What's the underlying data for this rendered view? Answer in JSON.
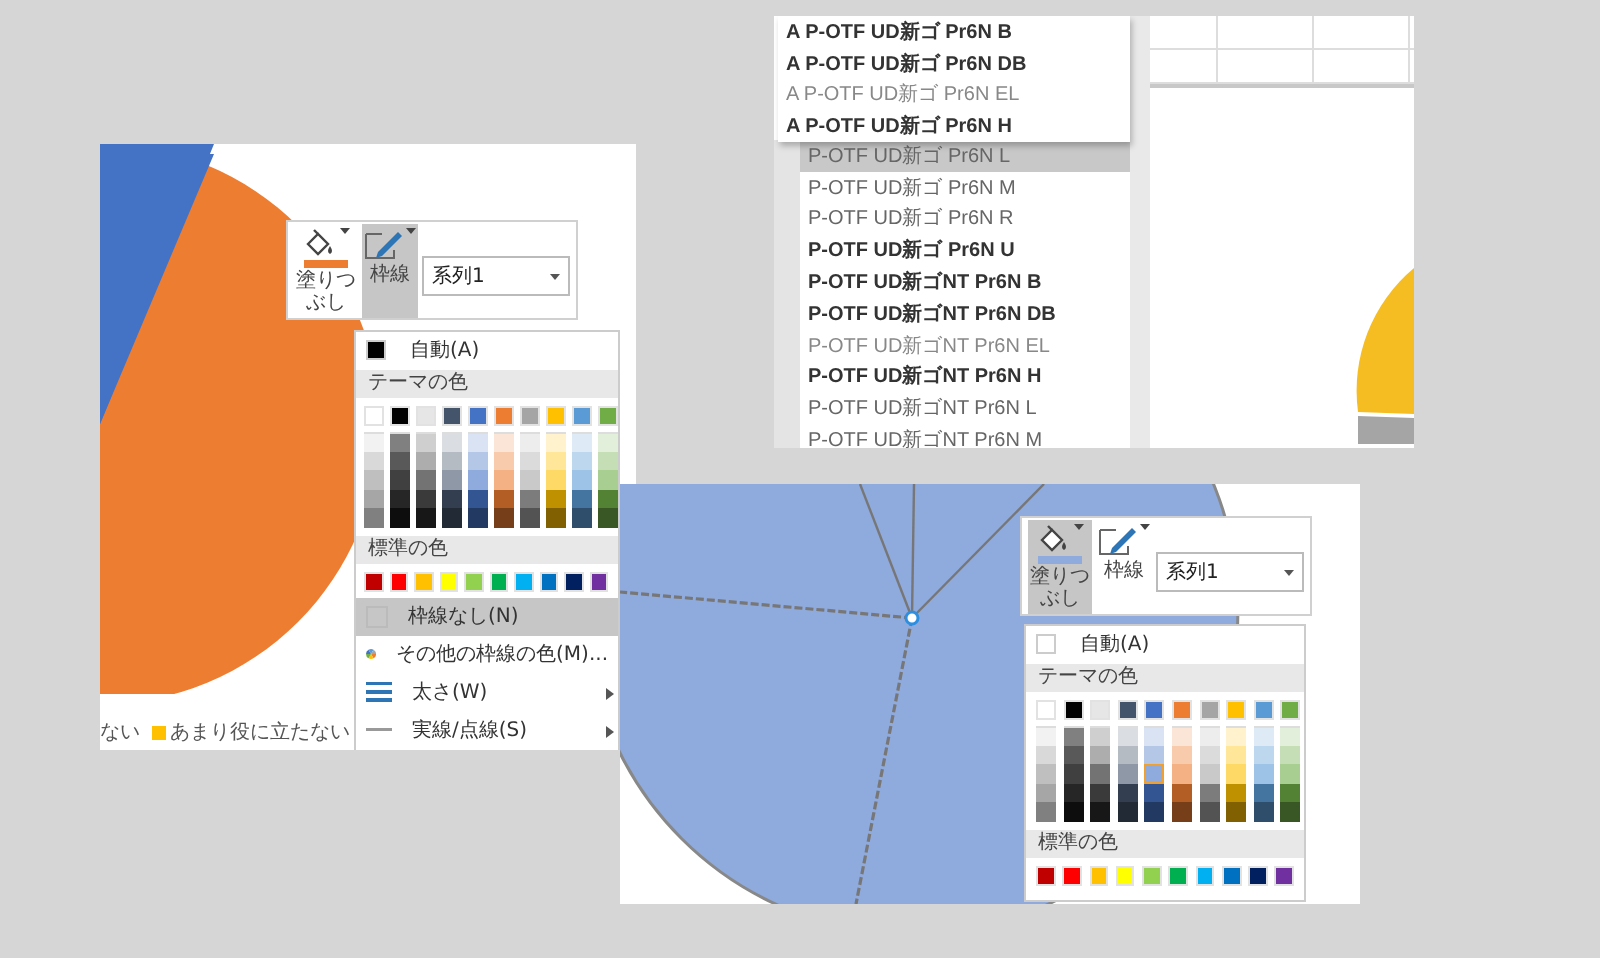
{
  "left_window": {
    "toolbar": {
      "buttons": [
        {
          "kind": "fill",
          "label": "塗りつぶし",
          "selected": false,
          "color": "#ed7d31"
        },
        {
          "kind": "outline",
          "label": "枠線",
          "selected": true
        }
      ],
      "series": "系列1"
    },
    "menu": [
      {
        "kind": "auto",
        "label": "自動(A)",
        "color": "#000000"
      },
      {
        "kind": "header",
        "label": "テーマの色"
      },
      {
        "kind": "theme_palette",
        "columns": [
          {
            "color": "#ffffff",
            "shades": [
              {
                "selected": false
              },
              {
                "selected": false
              },
              {
                "selected": false
              },
              {
                "selected": false
              },
              {
                "selected": false
              }
            ]
          },
          {
            "color": "#000000",
            "shades": [
              {
                "selected": false
              },
              {
                "selected": false
              },
              {
                "selected": false
              },
              {
                "selected": false
              },
              {
                "selected": false
              }
            ]
          },
          {
            "color": "#e7e6e6",
            "shades": [
              {
                "selected": false
              },
              {
                "selected": false
              },
              {
                "selected": false
              },
              {
                "selected": false
              },
              {
                "selected": false
              }
            ]
          },
          {
            "color": "#44546a",
            "shades": [
              {
                "selected": false
              },
              {
                "selected": false
              },
              {
                "selected": false
              },
              {
                "selected": false
              },
              {
                "selected": false
              }
            ]
          },
          {
            "color": "#4472c4",
            "shades": [
              {
                "selected": false
              },
              {
                "selected": false
              },
              {
                "selected": false
              },
              {
                "selected": false
              },
              {
                "selected": false
              }
            ]
          },
          {
            "color": "#ed7d31",
            "shades": [
              {
                "selected": false
              },
              {
                "selected": false
              },
              {
                "selected": false
              },
              {
                "selected": false
              },
              {
                "selected": false
              }
            ]
          },
          {
            "color": "#a5a5a5",
            "shades": [
              {
                "selected": false
              },
              {
                "selected": false
              },
              {
                "selected": false
              },
              {
                "selected": false
              },
              {
                "selected": false
              }
            ]
          },
          {
            "color": "#ffc000",
            "shades": [
              {
                "selected": false
              },
              {
                "selected": false
              },
              {
                "selected": false
              },
              {
                "selected": false
              },
              {
                "selected": false
              }
            ]
          },
          {
            "color": "#5b9bd5",
            "shades": [
              {
                "selected": false
              },
              {
                "selected": false
              },
              {
                "selected": false
              },
              {
                "selected": false
              },
              {
                "selected": false
              }
            ]
          },
          {
            "color": "#70ad47",
            "shades": [
              {
                "selected": false
              },
              {
                "selected": false
              },
              {
                "selected": false
              },
              {
                "selected": false
              },
              {
                "selected": false
              }
            ]
          }
        ]
      },
      {
        "kind": "header",
        "label": "標準の色"
      },
      {
        "kind": "standard_palette",
        "colors": [
          {
            "color": "#c00000"
          },
          {
            "color": "#ff0000"
          },
          {
            "color": "#ffc000"
          },
          {
            "color": "#ffff00"
          },
          {
            "color": "#92d050"
          },
          {
            "color": "#00b050"
          },
          {
            "color": "#00b0f0"
          },
          {
            "color": "#0070c0"
          },
          {
            "color": "#002060"
          },
          {
            "color": "#7030a0"
          }
        ]
      },
      {
        "kind": "nocolor",
        "label": "枠線なし(N)",
        "selected": true,
        "submenu": false
      },
      {
        "kind": "morecolors",
        "label": "その他の枠線の色(M)...",
        "selected": false,
        "submenu": false
      },
      {
        "kind": "weight",
        "label": "太さ(W)",
        "selected": false,
        "submenu": true
      },
      {
        "kind": "linestyle",
        "label": "実線/点線(S)",
        "selected": false,
        "submenu": true
      }
    ],
    "legend": [
      {
        "label": "ない"
      },
      {
        "label": "あまり役に立たない",
        "color": "#ffc000"
      }
    ]
  },
  "font_window": {
    "popup": [
      {
        "label": "A P-OTF UD新ゴ Pr6N B",
        "kind": "bold"
      },
      {
        "label": "A P-OTF UD新ゴ Pr6N DB",
        "kind": "bold"
      },
      {
        "label": "A P-OTF UD新ゴ Pr6N EL",
        "kind": "light"
      },
      {
        "label": "A P-OTF UD新ゴ Pr6N H",
        "kind": "bold"
      }
    ],
    "list": [
      {
        "label": "P-OTF UD新ゴ Pr6N L",
        "kind": "normal",
        "selected": true
      },
      {
        "label": "P-OTF UD新ゴ Pr6N M",
        "kind": "normal",
        "selected": false
      },
      {
        "label": "P-OTF UD新ゴ Pr6N R",
        "kind": "normal",
        "selected": false
      },
      {
        "label": "P-OTF UD新ゴ Pr6N U",
        "kind": "bold",
        "selected": false
      },
      {
        "label": "P-OTF UD新ゴNT Pr6N B",
        "kind": "bold",
        "selected": false
      },
      {
        "label": "P-OTF UD新ゴNT Pr6N DB",
        "kind": "bold",
        "selected": false
      },
      {
        "label": "P-OTF UD新ゴNT Pr6N EL",
        "kind": "light",
        "selected": false
      },
      {
        "label": "P-OTF UD新ゴNT Pr6N H",
        "kind": "bold",
        "selected": false
      },
      {
        "label": "P-OTF UD新ゴNT Pr6N L",
        "kind": "normal",
        "selected": false
      },
      {
        "label": "P-OTF UD新ゴNT Pr6N M",
        "kind": "normal",
        "selected": false
      }
    ]
  },
  "right_window": {
    "toolbar": {
      "buttons": [
        {
          "kind": "fill",
          "label": "塗りつぶし",
          "selected": true,
          "color": "#8faadc"
        },
        {
          "kind": "outline",
          "label": "枠線",
          "selected": false
        }
      ],
      "series": "系列1"
    },
    "menu": [
      {
        "kind": "auto",
        "label": "自動(A)",
        "color": "#ffffff"
      },
      {
        "kind": "header",
        "label": "テーマの色"
      },
      {
        "kind": "theme_palette",
        "columns": [
          {
            "color": "#ffffff",
            "shades": [
              {
                "selected": false
              },
              {
                "selected": false
              },
              {
                "selected": false
              },
              {
                "selected": false
              },
              {
                "selected": false
              }
            ]
          },
          {
            "color": "#000000",
            "shades": [
              {
                "selected": false
              },
              {
                "selected": false
              },
              {
                "selected": false
              },
              {
                "selected": false
              },
              {
                "selected": false
              }
            ]
          },
          {
            "color": "#e7e6e6",
            "shades": [
              {
                "selected": false
              },
              {
                "selected": false
              },
              {
                "selected": false
              },
              {
                "selected": false
              },
              {
                "selected": false
              }
            ]
          },
          {
            "color": "#44546a",
            "shades": [
              {
                "selected": false
              },
              {
                "selected": false
              },
              {
                "selected": false
              },
              {
                "selected": false
              },
              {
                "selected": false
              }
            ]
          },
          {
            "color": "#4472c4",
            "shades": [
              {
                "selected": false
              },
              {
                "selected": false
              },
              {
                "selected": true
              },
              {
                "selected": false
              },
              {
                "selected": false
              }
            ]
          },
          {
            "color": "#ed7d31",
            "shades": [
              {
                "selected": false
              },
              {
                "selected": false
              },
              {
                "selected": false
              },
              {
                "selected": false
              },
              {
                "selected": false
              }
            ]
          },
          {
            "color": "#a5a5a5",
            "shades": [
              {
                "selected": false
              },
              {
                "selected": false
              },
              {
                "selected": false
              },
              {
                "selected": false
              },
              {
                "selected": false
              }
            ]
          },
          {
            "color": "#ffc000",
            "shades": [
              {
                "selected": false
              },
              {
                "selected": false
              },
              {
                "selected": false
              },
              {
                "selected": false
              },
              {
                "selected": false
              }
            ]
          },
          {
            "color": "#5b9bd5",
            "shades": [
              {
                "selected": false
              },
              {
                "selected": false
              },
              {
                "selected": false
              },
              {
                "selected": false
              },
              {
                "selected": false
              }
            ]
          },
          {
            "color": "#70ad47",
            "shades": [
              {
                "selected": false
              },
              {
                "selected": false
              },
              {
                "selected": false
              },
              {
                "selected": false
              },
              {
                "selected": false
              }
            ]
          }
        ]
      },
      {
        "kind": "header",
        "label": "標準の色"
      },
      {
        "kind": "standard_palette",
        "colors": [
          {
            "color": "#c00000"
          },
          {
            "color": "#ff0000"
          },
          {
            "color": "#ffc000"
          },
          {
            "color": "#ffff00"
          },
          {
            "color": "#92d050"
          },
          {
            "color": "#00b050"
          },
          {
            "color": "#00b0f0"
          },
          {
            "color": "#0070c0"
          },
          {
            "color": "#002060"
          },
          {
            "color": "#7030a0"
          }
        ]
      }
    ]
  }
}
